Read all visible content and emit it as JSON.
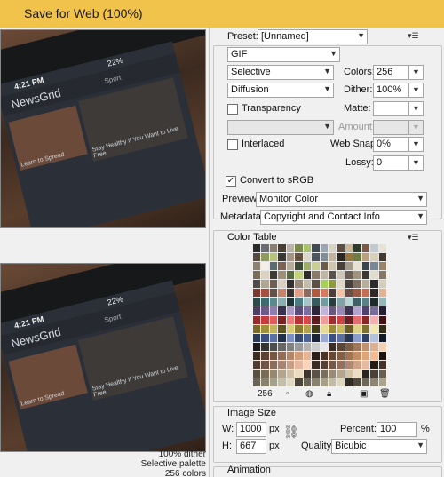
{
  "window": {
    "title": "Save for Web (100%)"
  },
  "preview": {
    "status_time": "4:21 PM",
    "battery": "22%",
    "app_brand": "NewsGrid",
    "section": "Sport",
    "card_caption_1": "Stay Healthy If You Want to Live Free",
    "card_caption_2": "Learn to Spread",
    "info_lines": [
      "100% dither",
      "Selective palette",
      "256 colors"
    ]
  },
  "settings": {
    "preset_label": "Preset:",
    "preset_value": "[Unnamed]",
    "format_value": "GIF",
    "reduction_value": "Selective",
    "colors_label": "Colors:",
    "colors_value": "256",
    "dither_algo_value": "Diffusion",
    "dither_label": "Dither:",
    "dither_value": "100%",
    "transparency_label": "Transparency",
    "matte_label": "Matte:",
    "amount_label": "Amount:",
    "interlaced_label": "Interlaced",
    "websnap_label": "Web Snap:",
    "websnap_value": "0%",
    "lossy_label": "Lossy:",
    "lossy_value": "0",
    "convert_label": "Convert to sRGB",
    "preview_label": "Preview:",
    "preview_value": "Monitor Color",
    "metadata_label": "Metadata:",
    "metadata_value": "Copyright and Contact Info"
  },
  "color_table": {
    "title": "Color Table",
    "count": "256",
    "colors": [
      "#2a2a2a",
      "#6c6c74",
      "#8a7f72",
      "#4a3d33",
      "#b9b3a8",
      "#7b8a4a",
      "#a8c36a",
      "#3e4a54",
      "#9aa7b3",
      "#d6d2c6",
      "#5d5040",
      "#c8b89a",
      "#2f3b2a",
      "#7a5a44",
      "#c2c9cf",
      "#e6e3d6",
      "#55483c",
      "#8e9b5e",
      "#b6c47a",
      "#3a3631",
      "#a39584",
      "#65523f",
      "#dcd7c7",
      "#4b5660",
      "#7f8d99",
      "#c0b39e",
      "#2b2622",
      "#97733c",
      "#6f7a44",
      "#b8a27e",
      "#d9cfb6",
      "#45382e",
      "#8f8171",
      "#f2efe6",
      "#5c6a72",
      "#7c6250",
      "#b5ab98",
      "#3d4a3a",
      "#9ead6a",
      "#c9cf8f",
      "#6a5b4a",
      "#d0c4aa",
      "#4a4035",
      "#a49a8a",
      "#e8e2d2",
      "#38444e",
      "#7a8896",
      "#9b8368",
      "#7a6b5b",
      "#dad3c2",
      "#3f3a34",
      "#a18f76",
      "#586b40",
      "#c4d27c",
      "#2e2a27",
      "#8a7a66",
      "#bfb6a2",
      "#59514a",
      "#cfc7b5",
      "#6c5f52",
      "#9f927f",
      "#3b3632",
      "#e2dccd",
      "#867665",
      "#4d4a47",
      "#b0a590",
      "#6e6053",
      "#d8d0bd",
      "#33302d",
      "#96877a",
      "#c5bca8",
      "#5b4f44",
      "#a6d05e",
      "#8c9a3a",
      "#e1d9c6",
      "#47403a",
      "#7d6f61",
      "#b9ae9a",
      "#2d2a28",
      "#d3ccb9",
      "#7c3a2e",
      "#a85040",
      "#61524a",
      "#c9826a",
      "#3b3330",
      "#e0a08a",
      "#8e6a5c",
      "#b35a3e",
      "#d87a5e",
      "#4e3f3a",
      "#f0c4a4",
      "#6d5044",
      "#995a46",
      "#c46e52",
      "#2f2826",
      "#e3b194",
      "#2b4a4c",
      "#3d6b70",
      "#5a8a8e",
      "#88b0b4",
      "#1f3537",
      "#4c7c82",
      "#a4c6c8",
      "#365c62",
      "#6e9ca0",
      "#26403f",
      "#7fa5a8",
      "#b7d4d6",
      "#3f6166",
      "#598286",
      "#1b2c2d",
      "#93b7ba",
      "#4c3f66",
      "#6a5a8a",
      "#8d7db0",
      "#3a3052",
      "#a99bc8",
      "#5a4c7a",
      "#7c6ea0",
      "#2c2540",
      "#c0b4da",
      "#66587e",
      "#9888b8",
      "#3f3458",
      "#b2a6d0",
      "#4f4270",
      "#7a6c9c",
      "#251f36",
      "#9a2a2a",
      "#c43c3c",
      "#e55a5a",
      "#7c2222",
      "#f07a7a",
      "#b23434",
      "#d84848",
      "#5e1a1a",
      "#f39a9a",
      "#a02c2c",
      "#cc4242",
      "#6e1e1e",
      "#e46c6c",
      "#8a2626",
      "#f4b0b0",
      "#401212",
      "#7a6a2a",
      "#a0903c",
      "#c2b25a",
      "#5e5220",
      "#d8cc7a",
      "#8c7c32",
      "#b2a24c",
      "#443c18",
      "#e6dc98",
      "#9a8a38",
      "#c8b860",
      "#6a5c24",
      "#dcd08a",
      "#807030",
      "#f0e8b0",
      "#322c12",
      "#2a3a5a",
      "#3c5080",
      "#5a70a8",
      "#20304a",
      "#7a90c4",
      "#344870",
      "#4c6294",
      "#182238",
      "#98aad4",
      "#3a5082",
      "#5a6ea4",
      "#263658",
      "#8a9ccc",
      "#2e4066",
      "#b4c2e0",
      "#121a2a",
      "#1a1a1a",
      "#333333",
      "#4d4d4d",
      "#666666",
      "#808080",
      "#999999",
      "#b3b3b3",
      "#cccccc",
      "#e6e6e6",
      "#3a2c24",
      "#5c4434",
      "#7e5c44",
      "#9e7658",
      "#be9270",
      "#dcb090",
      "#f2d0b2",
      "#3c2c20",
      "#5a4030",
      "#785640",
      "#966c52",
      "#b48466",
      "#d09c7c",
      "#e8b494",
      "#2a1e16",
      "#4a3424",
      "#684832",
      "#865e42",
      "#a47452",
      "#c28c64",
      "#dea478",
      "#f4bc90",
      "#1e140e",
      "#503c30",
      "#6e5444",
      "#8c6c5a",
      "#aa8470",
      "#c89e88",
      "#e4b8a0",
      "#fcd2b8",
      "#3a2a22",
      "#584034",
      "#765848",
      "#94705c",
      "#b08872",
      "#cca288",
      "#e6baa0",
      "#241a14",
      "#44322a",
      "#5a5040",
      "#786c58",
      "#968870",
      "#b4a48a",
      "#d0c0a4",
      "#eadcc0",
      "#3e362c",
      "#5c5244",
      "#7a6e5c",
      "#988a74",
      "#b6a68e",
      "#d2c2a8",
      "#ecdec4",
      "#282420",
      "#4a4238",
      "#686050",
      "#6a6456",
      "#888270",
      "#a6a08a",
      "#c4bea6",
      "#e0dac2",
      "#4c4638",
      "#6a6452",
      "#88826c",
      "#a6a088",
      "#c2bca4",
      "#deD8c0",
      "#302c24",
      "#504a3e",
      "#6e6858",
      "#8c8672",
      "#aaa48e"
    ]
  },
  "image_size": {
    "title": "Image Size",
    "w_label": "W:",
    "w_value": "1000",
    "h_label": "H:",
    "h_value": "667",
    "unit": "px",
    "percent_label": "Percent:",
    "percent_value": "100",
    "percent_unit": "%",
    "quality_label": "Quality:",
    "quality_value": "Bicubic"
  },
  "animation": {
    "title": "Animation"
  }
}
